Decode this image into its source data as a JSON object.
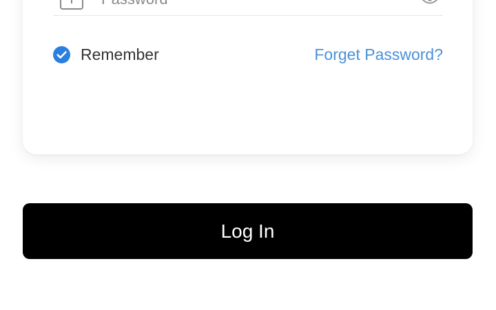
{
  "password_field": {
    "placeholder": "Password",
    "value": ""
  },
  "remember": {
    "label": "Remember",
    "checked": true
  },
  "forget_password": {
    "label": "Forget Password?"
  },
  "login_button": {
    "label": "Log In"
  },
  "colors": {
    "accent": "#2b7fe0",
    "link": "#4a90d9",
    "button_bg": "#000000",
    "button_text": "#ffffff"
  },
  "icons": {
    "lock": "lock-icon",
    "eye": "eye-icon",
    "check": "checkmark-circle-icon"
  }
}
